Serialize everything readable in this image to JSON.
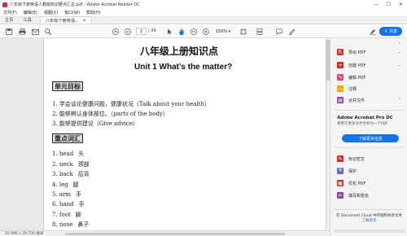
{
  "window": {
    "title": "八年级下册英语人教版知识要点汇总.pdf - Adobe Acrobat Reader DC",
    "minimize": "—",
    "maximize": "☐",
    "close": "✕"
  },
  "menu": [
    "文件(F)",
    "编辑(E)",
    "视图(V)",
    "窗口(W)",
    "帮助(H)"
  ],
  "tabs": {
    "home": "主页",
    "tools": "工具",
    "doc": "八年级下册英语...",
    "doc_close": "×"
  },
  "toolbar": {
    "current_page": "2",
    "total_pages": "/ 39",
    "zoom": "150%",
    "share_label": "共享"
  },
  "document": {
    "title": "八年级上册知识点",
    "subtitle": "Unit 1 What’s the matter?",
    "section1_heading": "单元目标",
    "objectives": [
      "1.  学会谈论健康问题，健康状况（Talk about your health）",
      "2.  能够辨认身体部位。（parts of the body）",
      "3.  能够提供建议（Give advice）"
    ],
    "section2_heading": "重点词汇",
    "vocab": [
      {
        "en": "1. head",
        "cn": "头"
      },
      {
        "en": "2. neck",
        "cn": "颈部"
      },
      {
        "en": "3. back",
        "cn": "后背"
      },
      {
        "en": "4. leg",
        "cn": "腿"
      },
      {
        "en": "5. arm",
        "cn": "手"
      },
      {
        "en": "6. hand",
        "cn": "手"
      },
      {
        "en": "7. foot",
        "cn": "脚"
      },
      {
        "en": "8. nose",
        "cn": "鼻子"
      }
    ]
  },
  "statusbar": {
    "size": "20.996 x 29.730 厘米"
  },
  "rightpane": {
    "tools": [
      {
        "label": "导出 PDF",
        "icon": "export-pdf-icon",
        "color": "#d32f2f",
        "caret": true
      },
      {
        "label": "创建 PDF",
        "icon": "create-pdf-icon",
        "color": "#d32f2f",
        "caret": true
      },
      {
        "label": "编辑 PDF",
        "icon": "edit-pdf-icon",
        "color": "#e0447c",
        "caret": false
      },
      {
        "label": "注释",
        "icon": "comment-icon",
        "color": "#f0a500",
        "caret": false
      },
      {
        "label": "合并文件",
        "icon": "combine-files-icon",
        "color": "#8e44ad",
        "caret": true
      }
    ],
    "promo_title": "Adobe Acrobat Pro DC",
    "promo_text": "将用于更多文件合并为一个PDF",
    "promo_button": "了解更多信息",
    "tools2": [
      {
        "label": "标记密文",
        "icon": "redact-icon",
        "color": "#d32f2f"
      },
      {
        "label": "保护",
        "icon": "protect-icon",
        "color": "#5c6bc0"
      },
      {
        "label": "优化 PDF",
        "icon": "optimize-pdf-icon",
        "color": "#d32f2f"
      },
      {
        "label": "填写和签名",
        "icon": "fill-sign-icon",
        "color": "#8e44ad"
      }
    ],
    "footer": "在 Document Cloud 中存储和共享文件",
    "footer_link": "了解更多"
  }
}
